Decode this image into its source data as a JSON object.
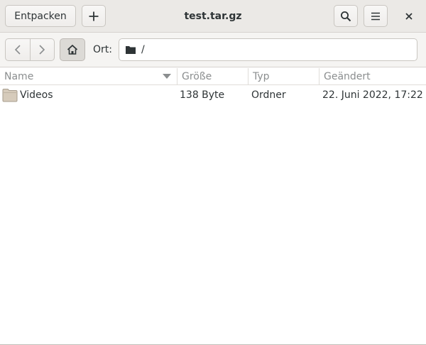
{
  "window": {
    "title": "test.tar.gz"
  },
  "headerbar": {
    "extract_label": "Entpacken",
    "add_icon": "plus-icon",
    "search_icon": "search-icon",
    "menu_icon": "hamburger-menu-icon",
    "close_icon": "close-icon"
  },
  "toolbar": {
    "back_icon": "chevron-left-icon",
    "forward_icon": "chevron-right-icon",
    "home_icon": "home-icon",
    "location_label": "Ort:",
    "location_path": "/",
    "location_icon": "folder-icon"
  },
  "columns": {
    "name": "Name",
    "size": "Größe",
    "type": "Typ",
    "modified": "Geändert"
  },
  "files": [
    {
      "name": "Videos",
      "size": "138 Byte",
      "type": "Ordner",
      "modified": "22. Juni 2022, 17:22",
      "icon": "folder-icon"
    }
  ],
  "colors": {
    "headerbar_bg": "#ebe9e6",
    "toolbar_bg": "#f5f4f2",
    "header_text": "#8b8e8f",
    "text": "#2e3436",
    "folder": "#d6cbbb"
  }
}
